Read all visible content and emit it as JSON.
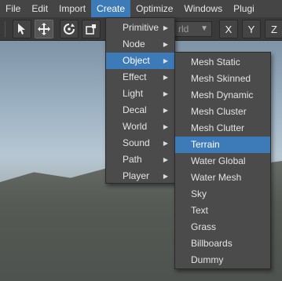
{
  "menubar": {
    "items": [
      "File",
      "Edit",
      "Import",
      "Create",
      "Optimize",
      "Windows",
      "Plugi"
    ]
  },
  "toolbar": {
    "world_select_value": "rld",
    "axis_x": "X",
    "axis_y": "Y",
    "axis_z": "Z"
  },
  "create_menu": {
    "items": [
      {
        "label": "Primitive",
        "has_submenu": true
      },
      {
        "label": "Node",
        "has_submenu": true
      },
      {
        "label": "Object",
        "has_submenu": true,
        "highlighted": true
      },
      {
        "label": "Effect",
        "has_submenu": true
      },
      {
        "label": "Light",
        "has_submenu": true
      },
      {
        "label": "Decal",
        "has_submenu": true
      },
      {
        "label": "World",
        "has_submenu": true
      },
      {
        "label": "Sound",
        "has_submenu": true
      },
      {
        "label": "Path",
        "has_submenu": true
      },
      {
        "label": "Player",
        "has_submenu": true
      }
    ]
  },
  "object_menu": {
    "items": [
      {
        "label": "Mesh Static"
      },
      {
        "label": "Mesh Skinned"
      },
      {
        "label": "Mesh Dynamic"
      },
      {
        "label": "Mesh Cluster"
      },
      {
        "label": "Mesh Clutter"
      },
      {
        "label": "Terrain",
        "highlighted": true
      },
      {
        "label": "Water Global"
      },
      {
        "label": "Water Mesh"
      },
      {
        "label": "Sky"
      },
      {
        "label": "Text"
      },
      {
        "label": "Grass"
      },
      {
        "label": "Billboards"
      },
      {
        "label": "Dummy"
      }
    ]
  },
  "colors": {
    "highlight": "#3d7ab8",
    "menu_bg": "#4b4b4b",
    "menubar_bg": "#454545"
  }
}
